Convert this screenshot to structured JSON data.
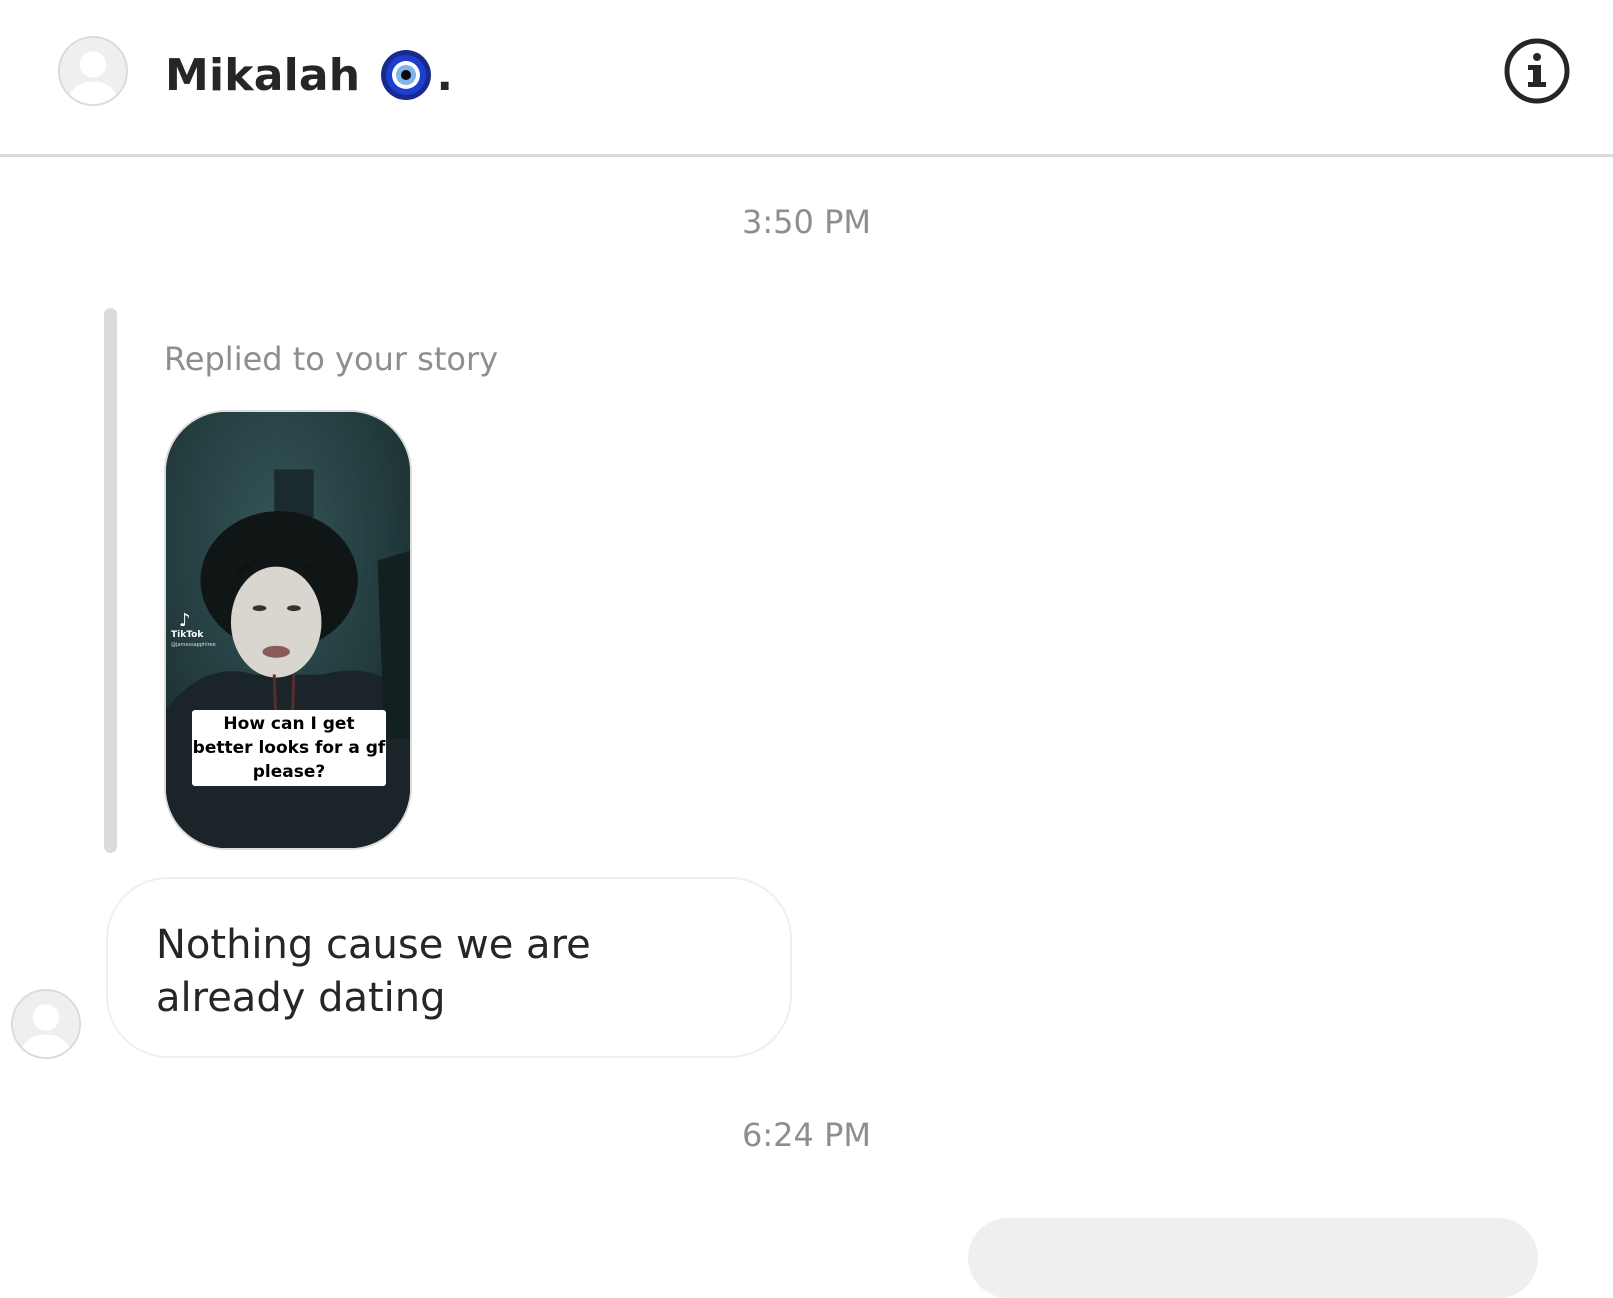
{
  "header": {
    "contact_name": "Mikalah",
    "name_suffix": ".",
    "name_emoji_icon": "nazar-amulet-icon",
    "info_icon": "info-icon"
  },
  "thread": {
    "timestamps": [
      "3:50 PM",
      "6:24 PM"
    ],
    "story_reply": {
      "label": "Replied to your story",
      "story": {
        "watermark": "TikTok",
        "handle": "@jamessapphiree",
        "caption": "How can I get better looks for a gf please?"
      }
    },
    "messages": [
      {
        "text": "Nothing cause we are already dating",
        "direction": "incoming"
      }
    ]
  },
  "colors": {
    "divider": "#dbdbdb",
    "muted_text": "#8e8e8e",
    "primary_text": "#262626",
    "bubble_border": "#efefef"
  }
}
